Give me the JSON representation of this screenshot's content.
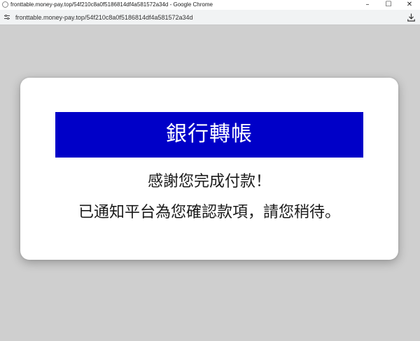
{
  "window": {
    "title": "fronttable.money-pay.top/54f210c8a0f5186814df4a581572a34d - Google Chrome",
    "minimize_glyph": "–",
    "maximize_glyph": "☐",
    "close_glyph": "✕"
  },
  "address_bar": {
    "url": "fronttable.money-pay.top/54f210c8a0f5186814df4a581572a34d",
    "left_icon": "site-settings-icon",
    "right_icon": "download-icon"
  },
  "modal": {
    "banner_title": "銀行轉帳",
    "message_line1": "感謝您完成付款！",
    "message_line2": "已通知平台為您確認款項，請您稍待。"
  },
  "colors": {
    "banner_bg": "#0000c8",
    "page_bg": "#cfcfcf"
  }
}
